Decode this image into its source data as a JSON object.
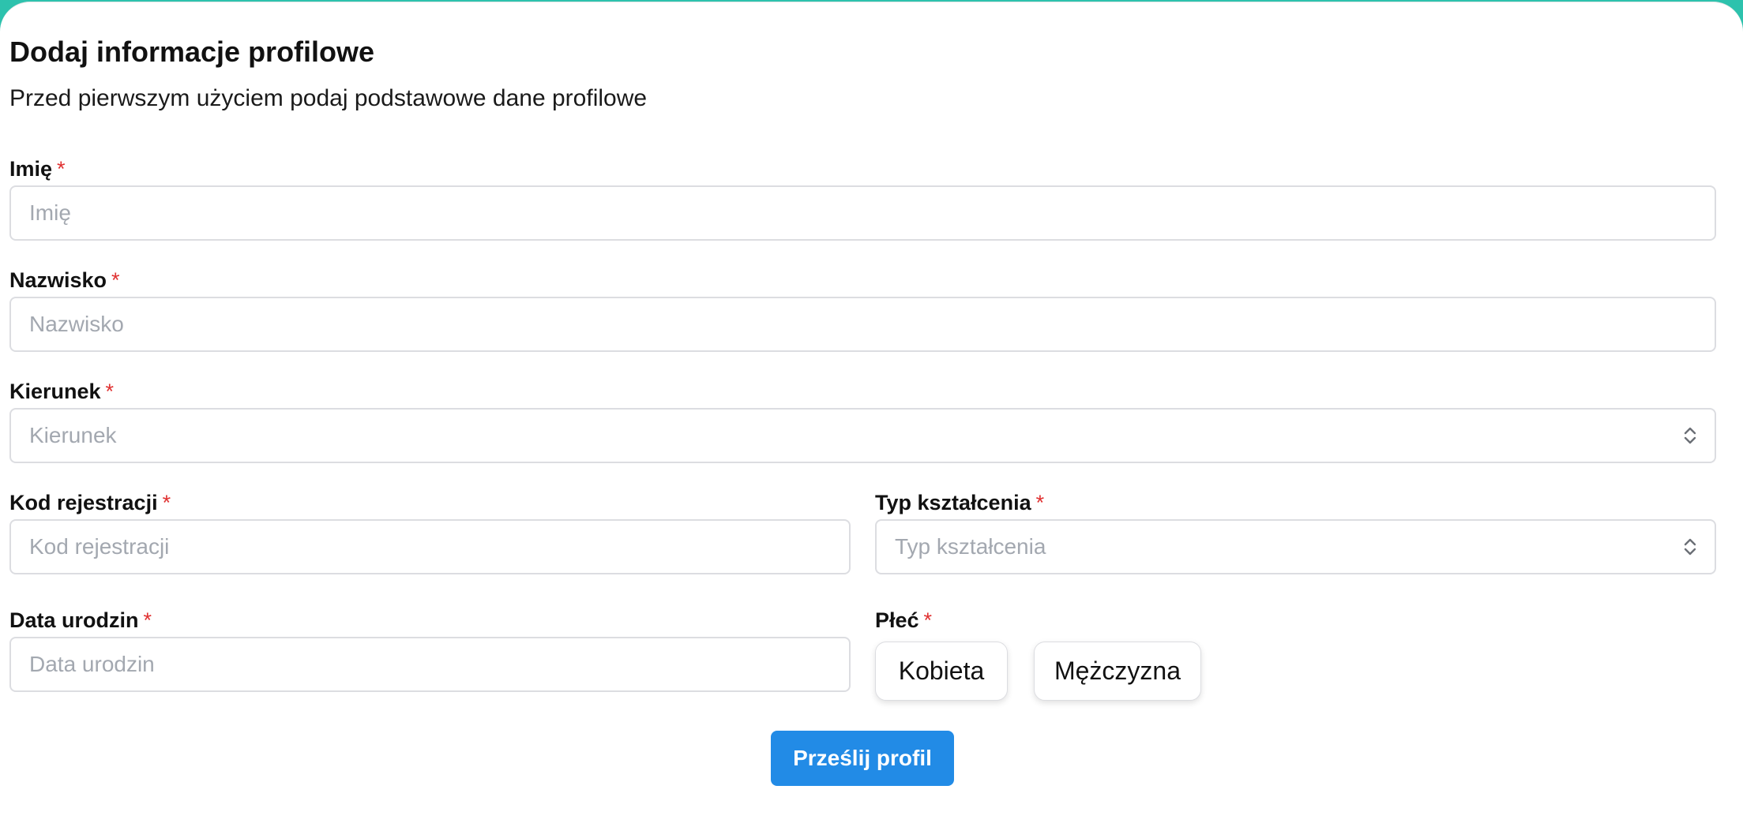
{
  "header": {
    "title": "Dodaj informacje profilowe",
    "subtitle": "Przed pierwszym użyciem podaj podstawowe dane profilowe"
  },
  "form": {
    "required_marker": "*",
    "first_name": {
      "label": "Imię",
      "placeholder": "Imię"
    },
    "last_name": {
      "label": "Nazwisko",
      "placeholder": "Nazwisko"
    },
    "field_of_study": {
      "label": "Kierunek",
      "placeholder": "Kierunek"
    },
    "registration_code": {
      "label": "Kod rejestracji",
      "placeholder": "Kod rejestracji"
    },
    "education_type": {
      "label": "Typ kształcenia",
      "placeholder": "Typ kształcenia"
    },
    "birth_date": {
      "label": "Data urodzin",
      "placeholder": "Data urodzin"
    },
    "gender": {
      "label": "Płeć",
      "options": [
        "Kobieta",
        "Mężczyzna"
      ]
    },
    "submit_label": "Prześlij profil"
  },
  "colors": {
    "accent": "#228be6",
    "required": "#e03131",
    "background": "#2dc2ad"
  },
  "icons": {
    "select_indicator": "chevron-up-down-icon"
  }
}
